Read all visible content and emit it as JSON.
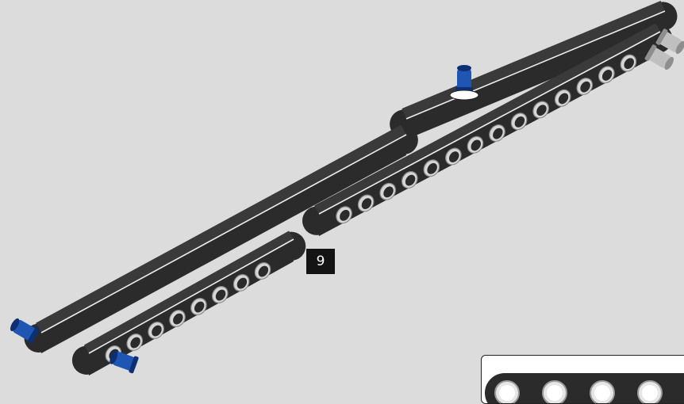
{
  "step": {
    "number": "9"
  },
  "colors": {
    "background": "#dcdcdc",
    "beam": "#2b2b2b",
    "beam_top": "#3a3a3a",
    "beam_edge": "#eeeeee",
    "hole_ring": "#d6d6d6",
    "pin_blue": "#1f56b3",
    "pin_blue_dark": "#0d2f74",
    "pin_grey": "#bfbfbf",
    "badge": "#141414"
  },
  "parts": [
    {
      "kind": "beam",
      "name": "lower-long-beam",
      "color": "black"
    },
    {
      "kind": "beam",
      "name": "lower-short-beam",
      "color": "black"
    },
    {
      "kind": "beam",
      "name": "middle-beam",
      "color": "black"
    },
    {
      "kind": "beam",
      "name": "upper-long-beam",
      "color": "black"
    },
    {
      "kind": "pin",
      "name": "blue-pin",
      "color": "blue",
      "count": 3
    },
    {
      "kind": "pin",
      "name": "grey-pin",
      "color": "light grey",
      "count": 2
    }
  ]
}
